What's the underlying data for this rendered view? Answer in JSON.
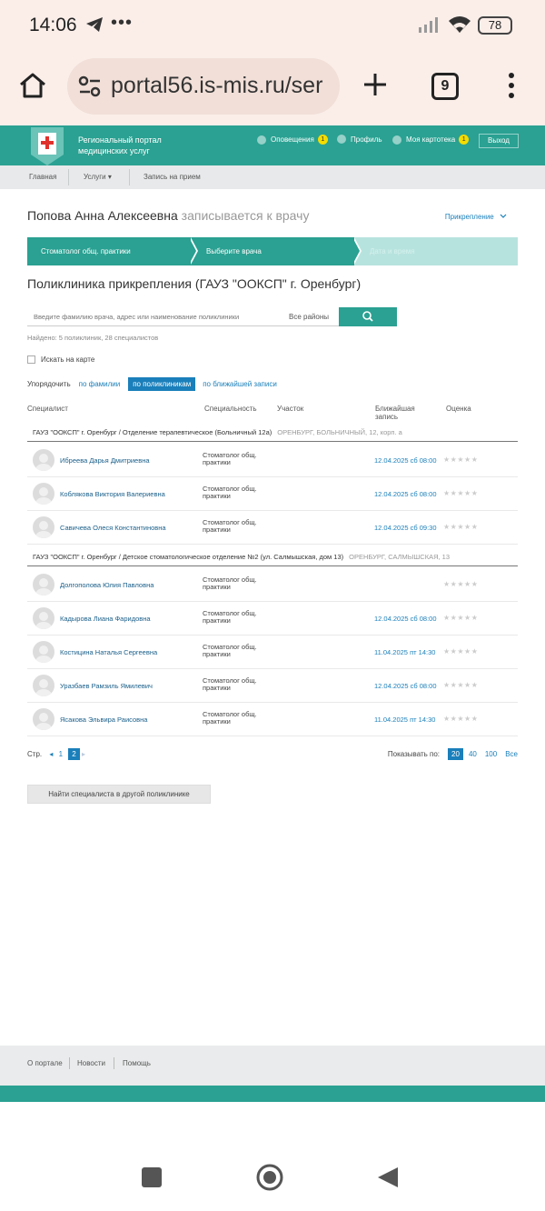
{
  "status_bar": {
    "time": "14:06",
    "more": "•••",
    "battery": "78"
  },
  "browser": {
    "url": "portal56.is-mis.ru/ser",
    "tab_count": "9"
  },
  "header": {
    "title_line1": "Региональный портал",
    "title_line2": "медицинских услуг",
    "notifications_label": "Оповещения",
    "notifications_count": "1",
    "profile_label": "Профиль",
    "card_label": "Моя картотека",
    "card_count": "1",
    "exit_label": "Выход"
  },
  "nav": {
    "home": "Главная",
    "services": "Услуги ▾",
    "appointment": "Запись на прием"
  },
  "patient": {
    "name": "Попова Анна Алексеевна",
    "action": "записывается к врачу",
    "attach_label": "Прикрепление"
  },
  "steps": [
    "Стоматолог общ. практики",
    "Выберите врача",
    "Дата и время"
  ],
  "clinic_title": "Поликлиника прикрепления (ГАУЗ \"ООКСП\" г. Оренбург)",
  "search": {
    "placeholder": "Введите фамилию врача, адрес или наименование поликлиники",
    "region": "Все районы",
    "found": "Найдено: 5 поликлиник, 28 специалистов",
    "map_label": "Искать на карте"
  },
  "sort": {
    "label": "Упорядочить",
    "by_name": "по фамилии",
    "by_clinic": "по поликлиникам",
    "by_nearest": "по ближайшей записи"
  },
  "table": {
    "headers": {
      "specialist": "Специалист",
      "specialty": "Специальность",
      "district": "Участок",
      "nearest_l1": "Ближайшая",
      "nearest_l2": "запись",
      "rating": "Оценка"
    },
    "groups": [
      {
        "title": "ГАУЗ \"ООКСП\" г. Оренбург / Отделение терапевтическое (Больничный 12а)",
        "address": "ОРЕНБУРГ, БОЛЬНИЧНЫЙ, 12, корп. а",
        "doctors": [
          {
            "name": "Ибреева Дарья Дмитриевна",
            "spec1": "Стоматолог общ.",
            "spec2": "практики",
            "slot": "12.04.2025 сб 08:00",
            "rating": "★★★★★"
          },
          {
            "name": "Коблякова Виктория Валериевна",
            "spec1": "Стоматолог общ.",
            "spec2": "практики",
            "slot": "12.04.2025 сб 08:00",
            "rating": "★★★★★"
          },
          {
            "name": "Савичева Олеся Константиновна",
            "spec1": "Стоматолог общ.",
            "spec2": "практики",
            "slot": "12.04.2025 сб 09:30",
            "rating": "★★★★★"
          }
        ]
      },
      {
        "title": "ГАУЗ \"ООКСП\" г. Оренбург / Детское стоматологическое отделение №2 (ул. Салмышская, дом 13)",
        "address": "ОРЕНБУРГ, САЛМЫШСКАЯ, 13",
        "doctors": [
          {
            "name": "Долгополова Юлия Павловна",
            "spec1": "Стоматолог общ.",
            "spec2": "практики",
            "slot": "",
            "rating": "★★★★★"
          },
          {
            "name": "Кадырова Лиана Фаридовна",
            "spec1": "Стоматолог общ.",
            "spec2": "практики",
            "slot": "12.04.2025 сб 08:00",
            "rating": "★★★★★"
          },
          {
            "name": "Костицина Наталья Сергеевна",
            "spec1": "Стоматолог общ.",
            "spec2": "практики",
            "slot": "11.04.2025 пт 14:30",
            "rating": "★★★★★"
          },
          {
            "name": "Уразбаев Рамзиль Ямилевич",
            "spec1": "Стоматолог общ.",
            "spec2": "практики",
            "slot": "12.04.2025 сб 08:00",
            "rating": "★★★★★"
          },
          {
            "name": "Ясакова Эльвира Раисовна",
            "spec1": "Стоматолог общ.",
            "spec2": "практики",
            "slot": "11.04.2025 пт 14:30",
            "rating": "★★★★★"
          }
        ]
      }
    ]
  },
  "pager": {
    "label": "Стр.",
    "prev": "◂",
    "pages": [
      "1",
      "2"
    ],
    "next": "▸",
    "show_label": "Показывать по:",
    "sizes": [
      "20",
      "40",
      "100",
      "Все"
    ]
  },
  "other_clinic_button": "Найти специалиста в другой поликлинике",
  "footer": {
    "about": "О портале",
    "news": "Новости",
    "help": "Помощь"
  },
  "colors": {
    "brand": "#2aa192",
    "link": "#1a7fba",
    "badge": "#f4dc00"
  }
}
